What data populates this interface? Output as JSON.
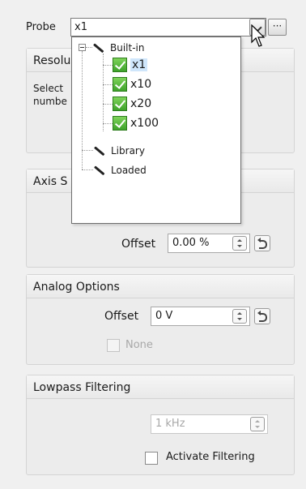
{
  "probe": {
    "label": "Probe",
    "value": "x1",
    "more_label": "···"
  },
  "dropdown": {
    "root": "Built-in",
    "builtin_items": [
      "x1",
      "x10",
      "x20",
      "x100"
    ],
    "library": "Library",
    "loaded": "Loaded"
  },
  "resolution": {
    "title": "Resolu",
    "description_line1": "Select",
    "description_line2": "numbe"
  },
  "axis": {
    "title": "Axis S",
    "offset_label": "Offset",
    "offset_value": "0.00 %"
  },
  "analog": {
    "title": "Analog Options",
    "offset_label": "Offset",
    "offset_value": "0 V",
    "none_label": "None"
  },
  "lowpass": {
    "title": "Lowpass Filtering",
    "freq_value": "1 kHz",
    "activate_label": "Activate Filtering"
  }
}
